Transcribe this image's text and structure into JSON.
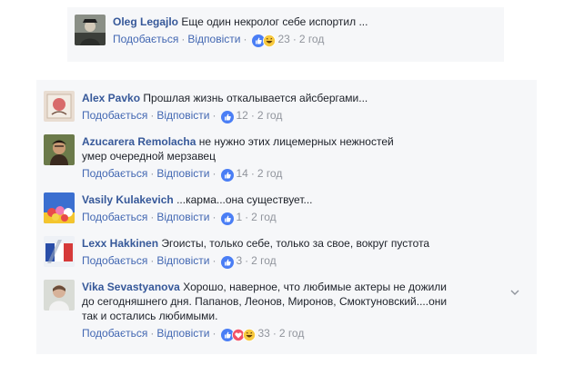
{
  "top_comment": {
    "author": "Oleg Legajlo",
    "text": "Еще один некролог себе испортил ...",
    "like_label": "Подобається",
    "reply_label": "Відповісти",
    "reaction_count": "23",
    "time": "2 год"
  },
  "comments": [
    {
      "author": "Alex Pavko",
      "text": "Прошлая жизнь откалывается айсбергами...",
      "like_label": "Подобається",
      "reply_label": "Відповісти",
      "reaction_count": "12",
      "time": "2 год"
    },
    {
      "author": "Azucarera Remolacha",
      "text_line1": "не нужно этих лицемерных нежностей",
      "text_line2": "умер очередной мерзавец",
      "like_label": "Подобається",
      "reply_label": "Відповісти",
      "reaction_count": "14",
      "time": "2 год"
    },
    {
      "author": "Vasily Kulakevich",
      "text": "...карма...она существует...",
      "like_label": "Подобається",
      "reply_label": "Відповісти",
      "reaction_count": "1",
      "time": "2 год"
    },
    {
      "author": "Lexx Hakkinen",
      "text": "Эгоисты, только себе, только за свое, вокруг пустота",
      "like_label": "Подобається",
      "reply_label": "Відповісти",
      "reaction_count": "3",
      "time": "2 год"
    },
    {
      "author": "Vika Sevastyanova",
      "text_line1": "Хорошо, наверное, что любимые актеры не дожили",
      "text_line2": "до сегодняшнего дня. Папанов, Леонов, Миронов, Смоктуновский....они",
      "text_line3": "так и остались любимыми.",
      "like_label": "Подобається",
      "reply_label": "Відповісти",
      "reaction_count": "33",
      "time": "2 год"
    }
  ],
  "separator": "·",
  "colors": {
    "name": "#365899",
    "link": "#4267b2",
    "meta": "#90949c",
    "panel_bg": "#f6f7f9",
    "like_blue": "#4a7ef5",
    "haha_yellow": "#f7c93e",
    "love_red": "#f25268"
  }
}
